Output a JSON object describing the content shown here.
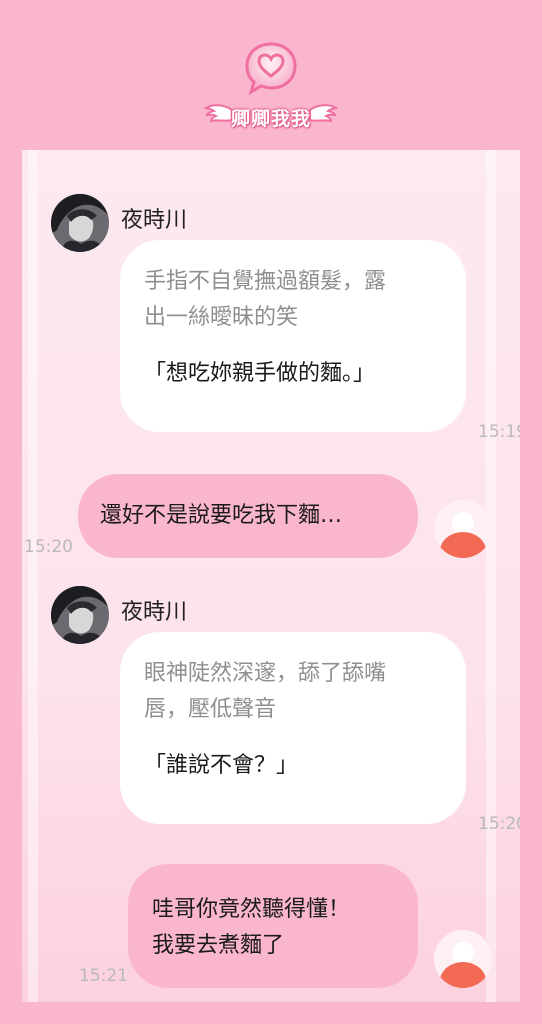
{
  "app": {
    "title": "卿卿我我",
    "logo_icon": "heart-chat-bubble-icon"
  },
  "colors": {
    "background": "#fbb6cf",
    "panel": "#fde9f0",
    "incoming_bubble": "#ffffff",
    "outgoing_bubble": "#fbb6cf",
    "timestamp": "#b9b9b9",
    "action_text": "#8f8f8f"
  },
  "messages": [
    {
      "side": "incoming",
      "sender": "夜時川",
      "action": "手指不自覺撫過額髮，露出一絲曖昧的笑",
      "action_line1": "手指不自覺撫過額髮，露",
      "action_line2": "出一絲曖昧的笑",
      "speech": "「想吃妳親手做的麵。」",
      "time": "15:19"
    },
    {
      "side": "outgoing",
      "text": "還好不是說要吃我下麵…",
      "time": "15:20"
    },
    {
      "side": "incoming",
      "sender": "夜時川",
      "action": "眼神陡然深邃，舔了舔嘴唇，壓低聲音",
      "action_line1": "眼神陡然深邃，舔了舔嘴",
      "action_line2": "唇，壓低聲音",
      "speech": "「誰說不會？」",
      "time": "15:20"
    },
    {
      "side": "outgoing",
      "text_line1": "哇哥你竟然聽得懂！",
      "text_line2": "我要去煮麵了",
      "time": "15:21"
    }
  ]
}
